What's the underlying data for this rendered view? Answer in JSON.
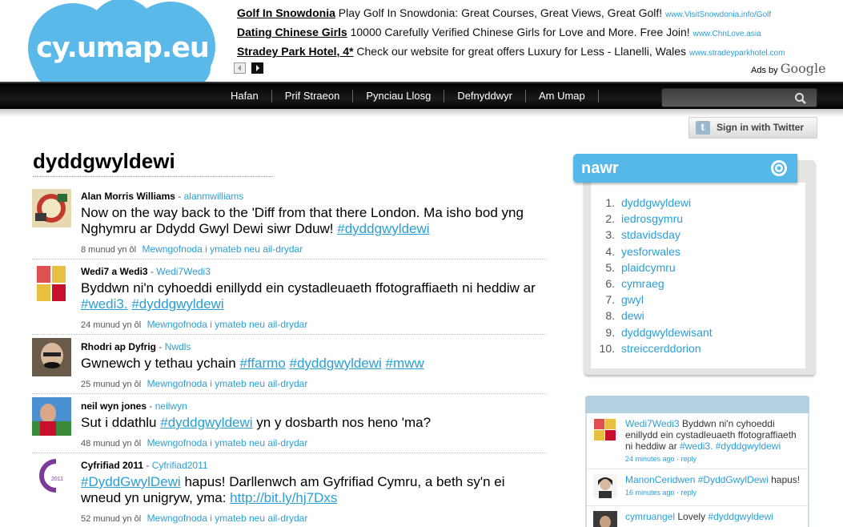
{
  "logo": {
    "text": "cy.umap.eu"
  },
  "ads": [
    {
      "title": "Golf In Snowdonia",
      "desc": "Play Golf In Snowdonia: Great Courses, Great Views, Great Golf!",
      "url": "www.VisitSnowdonia.info/Golf"
    },
    {
      "title": "Dating Chinese Girls",
      "desc": "10000 Carefully Verified Chinese Girls for Love and More. Free Join!",
      "url": "www.ChnLove.asia"
    },
    {
      "title": "Stradey Park Hotel, 4*",
      "desc": "Check our website for great offers Luxury for Less - Llanelli, Wales",
      "url": "www.stradeyparkhotel.com"
    }
  ],
  "adsby": {
    "prefix": "Ads by",
    "brand": "Google"
  },
  "nav": {
    "items": [
      "Hafan",
      "Prif Straeon",
      "Pynciau Llosg",
      "Defnyddwyr",
      "Am Umap"
    ]
  },
  "search": {
    "placeholder": ""
  },
  "signin": {
    "label": "Sign in with Twitter"
  },
  "page_title": "dyddgwyldewi",
  "tweets": [
    {
      "name": "Alan Morris Williams",
      "handle": "alanmwilliams",
      "text": "Now on the way back to the 'Diff from that there London. Ma isho bod yng Nghymru ar Ddydd Gwyl Dewi siwr Dduw!",
      "tags": [
        "#dyddgwyldewi"
      ],
      "time": "8 munud yn ôl",
      "actions": "Mewngofnoda i ymateb neu ail-drydar"
    },
    {
      "name": "Wedi7 a Wedi3",
      "handle": "Wedi7Wedi3",
      "text": "Byddwn ni'n cyhoeddi enillydd ein cystadleuaeth ffotograffiaeth ni heddiw ar",
      "tags": [
        "#wedi3.",
        "#dyddgwyldewi"
      ],
      "time": "24 munud yn ôl",
      "actions": "Mewngofnoda i ymateb neu ail-drydar"
    },
    {
      "name": "Rhodri ap Dyfrig",
      "handle": "Nwdls",
      "text": "Gwnewch y tethau ychain",
      "tags": [
        "#ffarmo",
        "#dyddgwyldewi",
        "#mww"
      ],
      "time": "25 munud yn ôl",
      "actions": "Mewngofnoda i ymateb neu ail-drydar"
    },
    {
      "name": "neil wyn jones",
      "handle": "neilwyn",
      "text_before": "Sut i ddathlu",
      "tag": "#dyddgwyldewi",
      "text_after": "yn y dosbarth nos heno 'ma?",
      "time": "48 munud yn ôl",
      "actions": "Mewngofnoda i ymateb neu ail-drydar"
    },
    {
      "name": "Cyfrifiad 2011",
      "handle": "Cyfrifiad2011",
      "tag": "#DyddGwylDewi",
      "text": "hapus! Darllenwch am Gyfrifiad Cymru, a beth sy'n ei wneud yn unigryw, yma:",
      "link": "http://bit.ly/hj7Dxs",
      "time": "52 munud yn ôl",
      "actions": "Mewngofnoda i ymateb neu ail-drydar"
    }
  ],
  "nawr": {
    "title": "nawr",
    "trends": [
      "dyddgwyldewi",
      "iedrosgymru",
      "stdavidsday",
      "yesforwales",
      "plaidcymru",
      "cymraeg",
      "gwyl",
      "dewi",
      "dyddgwyldewisant",
      "streiccerddorion"
    ]
  },
  "feed": [
    {
      "user": "Wedi7Wedi3",
      "text": "Byddwn ni'n cyhoeddi enillydd ein cystadleuaeth ffotograffiaeth ni heddiw ar",
      "tags": "#wedi3. #dyddgwyldewi",
      "time": "24 minutes ago · reply"
    },
    {
      "user": "ManonCeridwen",
      "tags": "#DyddGwylDewi",
      "text": "hapus!",
      "time": "16 minutes ago · reply"
    },
    {
      "user": "cymruangel",
      "text": "Lovely",
      "tags": "#dyddgwyldewi",
      "time": ""
    }
  ],
  "colors": {
    "accent": "#2a9fd6",
    "nawr_blue": "#55b8e8",
    "logo_blue": "#5bb9ea",
    "navbar": "#000000"
  }
}
